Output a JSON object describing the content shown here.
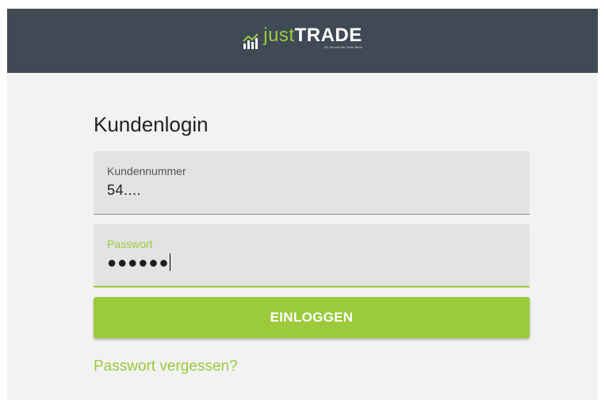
{
  "header": {
    "logo_just": "just",
    "logo_trade": "TRADE",
    "logo_tagline": "Ein Service der Sutor Bank",
    "logo_icon": "bar-chart-icon",
    "background_color": "#3f4a55",
    "accent_color": "#9bcb3b"
  },
  "login": {
    "title": "Kundenlogin",
    "customer_number": {
      "label": "Kundennummer",
      "value": "54...."
    },
    "password": {
      "label": "Passwort",
      "value": "●●●●●●"
    },
    "submit_label": "EINLOGGEN",
    "forgot_password_label": "Passwort vergessen?"
  },
  "colors": {
    "accent": "#9bcb3b",
    "panel_background": "#f2f2f2",
    "field_background": "#e3e3e3"
  }
}
